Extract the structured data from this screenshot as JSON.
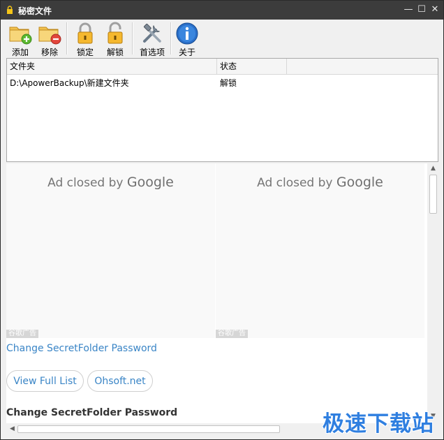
{
  "window": {
    "title": "秘密文件",
    "minimize": "—",
    "maximize": "☐",
    "close": "✕"
  },
  "toolbar": {
    "add": "添加",
    "remove": "移除",
    "lock": "锁定",
    "unlock": "解锁",
    "preferences": "首选项",
    "about": "关于"
  },
  "list": {
    "columns": [
      "文件夹",
      "状态"
    ],
    "rows": [
      {
        "folder": "D:\\ApowerBackup\\新建文件夹",
        "status": "解锁"
      }
    ]
  },
  "ads": [
    {
      "prefix": "Ad closed by",
      "brand": "Google",
      "mark": "谷歌广告"
    },
    {
      "prefix": "Ad closed by",
      "brand": "Google",
      "mark": "谷歌广告"
    }
  ],
  "content": {
    "link_change_password": "Change SecretFolder Password",
    "view_full_list": "View Full List",
    "ohsoft": "Ohsoft.net",
    "heading": "Change SecretFolder Password"
  },
  "watermark": "极速下载站",
  "colors": {
    "link": "#3a85c6",
    "titlebar": "#3c3c3c",
    "watermark": "#2f7fe0"
  }
}
